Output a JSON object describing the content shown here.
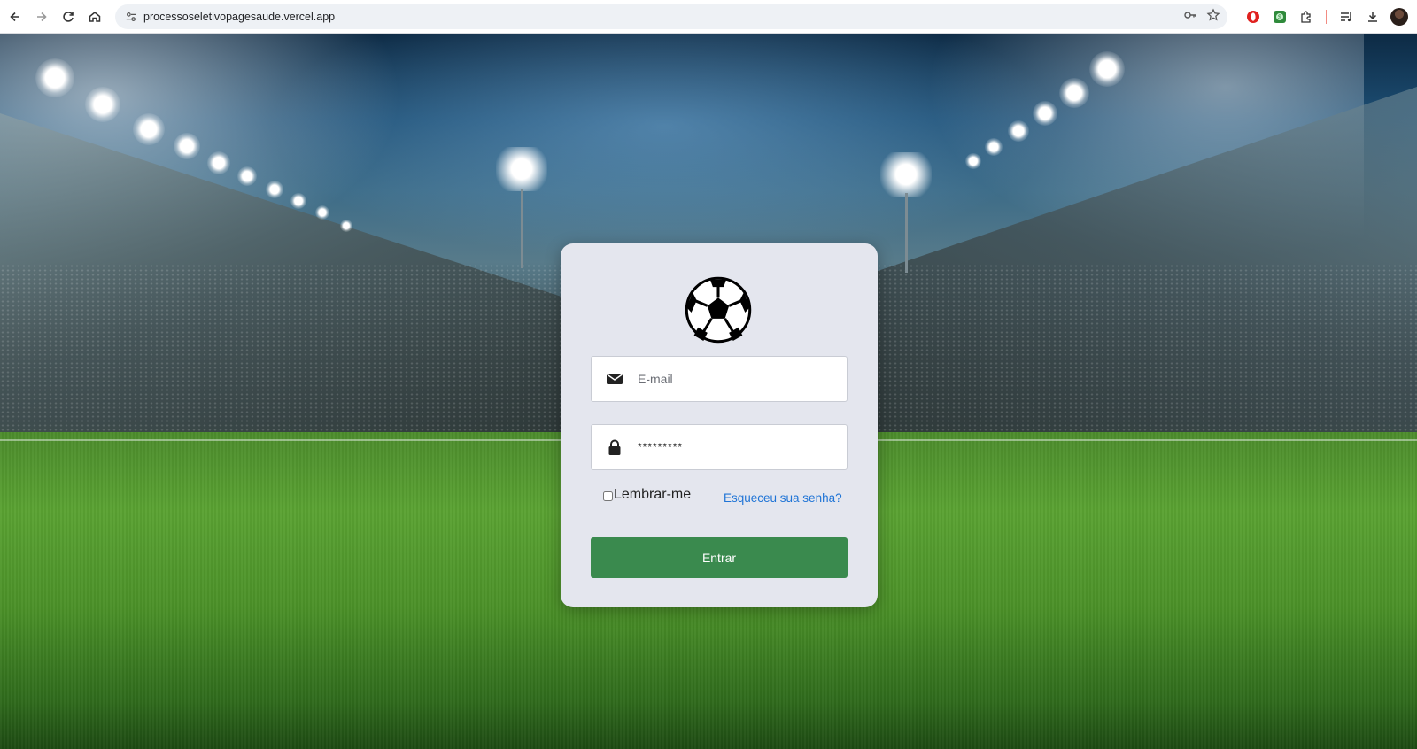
{
  "browser": {
    "url": "processoseletivopagesaude.vercel.app",
    "icons": [
      "back-icon",
      "forward-icon",
      "reload-icon",
      "home-icon",
      "site-info-icon",
      "password-key-icon",
      "bookmark-star-icon",
      "opera-extension-icon",
      "green-extension-icon",
      "puzzle-extensions-icon",
      "reading-list-icon",
      "download-icon",
      "profile-avatar"
    ]
  },
  "login": {
    "logo": "soccer-ball-icon",
    "email_placeholder": "E-mail",
    "password_value": "*********",
    "remember_label": "Lembrar-me",
    "forgot_label": "Esqueceu sua senha?",
    "submit_label": "Entrar"
  },
  "colors": {
    "card_bg": "#e4e6ee",
    "button_bg": "#3a8a4e",
    "link": "#1f74d6"
  }
}
